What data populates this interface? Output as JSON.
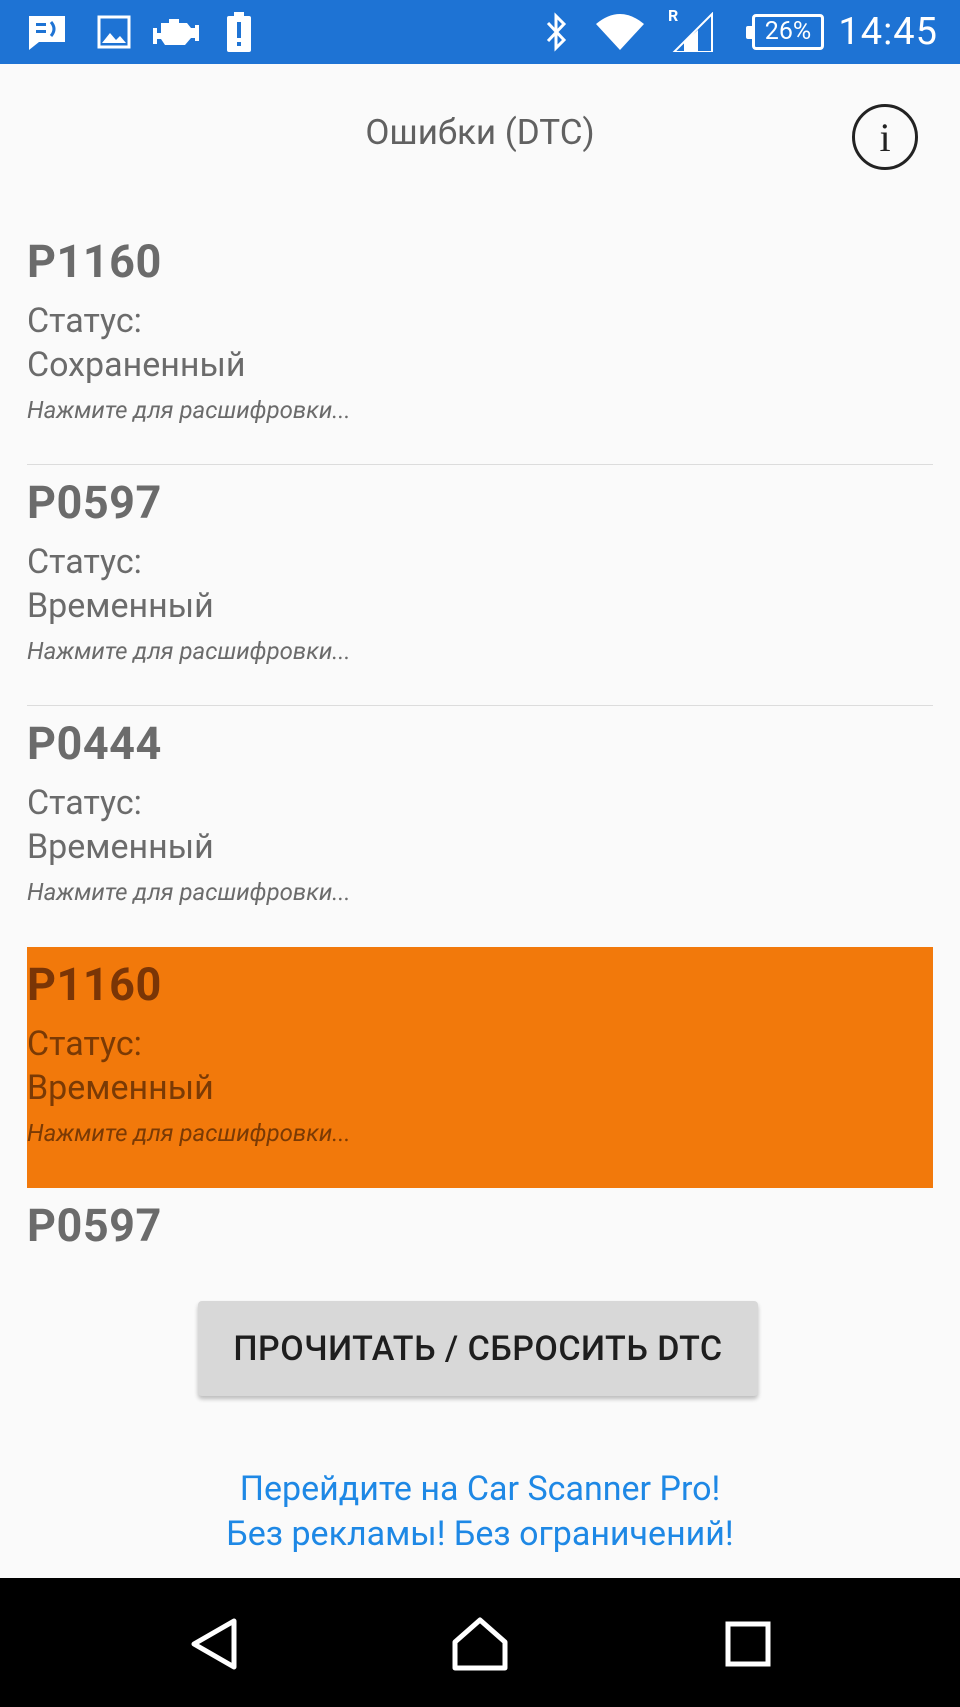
{
  "status_bar": {
    "time": "14:45",
    "battery": "26%",
    "icons": [
      "message-icon",
      "image-icon",
      "engine-icon",
      "battery-alert-icon",
      "bluetooth-icon",
      "wifi-icon",
      "signal-roaming-icon"
    ],
    "roaming_label": "R"
  },
  "header": {
    "title": "Ошибки (DTC)",
    "info_label": "i"
  },
  "dtc_list": [
    {
      "code": "P1160",
      "status_label": "Статус:",
      "status": "Сохраненный",
      "hint": "Нажмите для расшифровки...",
      "highlighted": false
    },
    {
      "code": "P0597",
      "status_label": "Статус:",
      "status": "Временный",
      "hint": "Нажмите для расшифровки...",
      "highlighted": false
    },
    {
      "code": "P0444",
      "status_label": "Статус:",
      "status": "Временный",
      "hint": "Нажмите для расшифровки...",
      "highlighted": false
    },
    {
      "code": "P1160",
      "status_label": "Статус:",
      "status": "Временный",
      "hint": "Нажмите для расшифровки...",
      "highlighted": true
    },
    {
      "code": "P0597"
    }
  ],
  "action_button": {
    "label": "ПРОЧИТАТЬ / СБРОСИТЬ DTC"
  },
  "promo": {
    "line1": "Перейдите на Car Scanner Pro!",
    "line2": "Без рекламы! Без ограничений!"
  },
  "colors": {
    "status_bar": "#1e73d4",
    "highlight": "#f2790b",
    "promo_link": "#1e88e5",
    "text": "#6b6b6b"
  },
  "nav_bar": {
    "icons": [
      "back-icon",
      "home-icon",
      "recents-icon"
    ]
  }
}
